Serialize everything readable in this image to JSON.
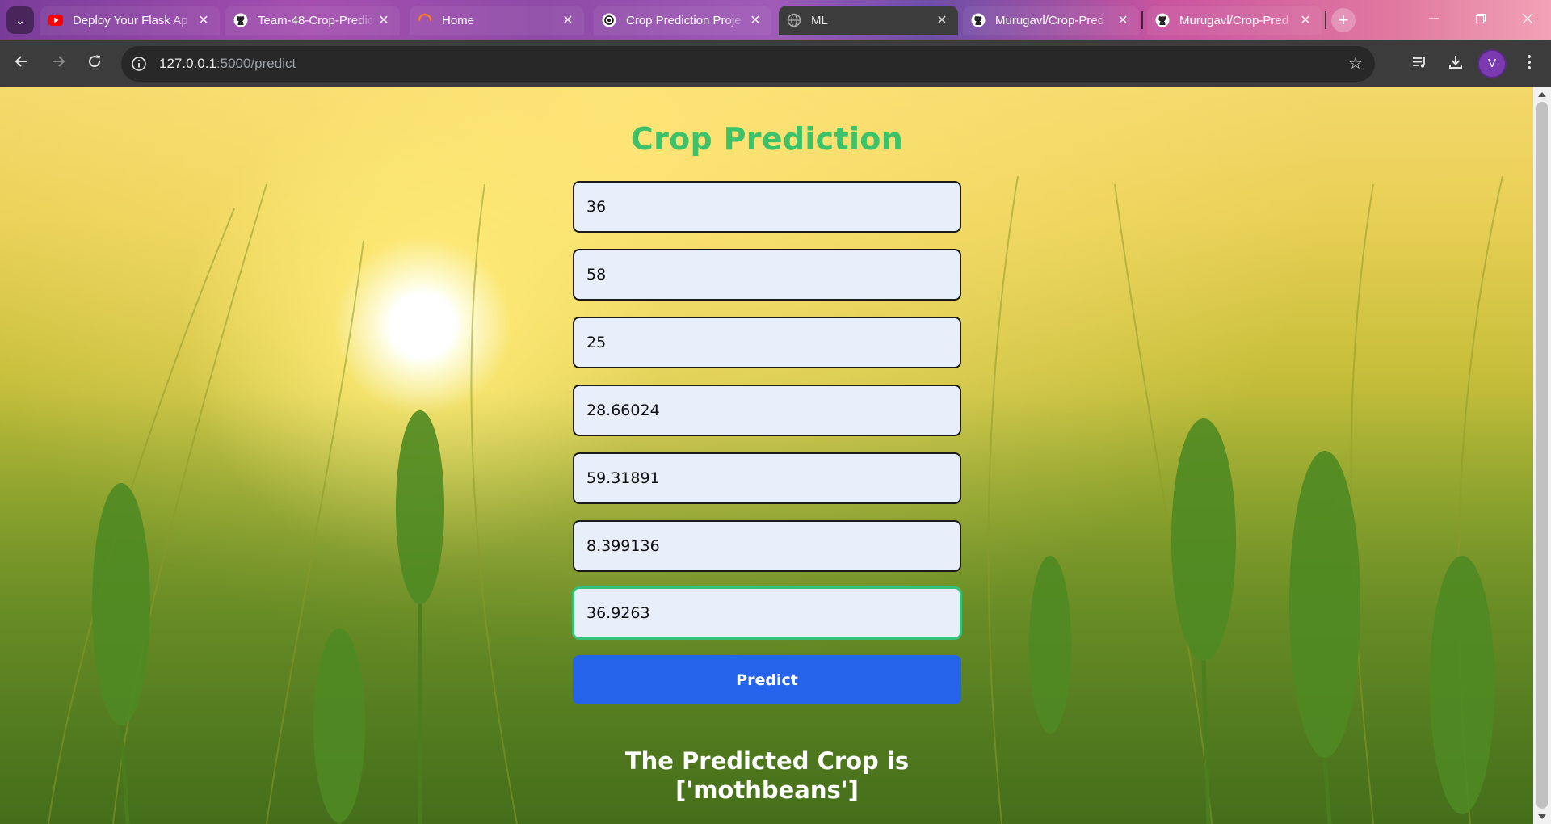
{
  "browser": {
    "tabs": [
      {
        "title": "Deploy Your Flask Ap",
        "favicon": "youtube-icon",
        "active": false
      },
      {
        "title": "Team-48-Crop-Predic",
        "favicon": "github-icon",
        "active": false
      },
      {
        "title": "Home",
        "favicon": "loading-spinner-icon",
        "active": false
      },
      {
        "title": "Crop Prediction Proje",
        "favicon": "openai-icon",
        "active": false
      },
      {
        "title": "ML",
        "favicon": "globe-icon",
        "active": true
      },
      {
        "title": "Murugavl/Crop-Pred",
        "favicon": "github-icon",
        "active": false
      },
      {
        "title": "Murugavl/Crop-Pred",
        "favicon": "github-icon",
        "active": false
      }
    ],
    "url_host": "127.0.0.1",
    "url_path": ":5000/predict",
    "profile_initial": "V",
    "accent": "#7b3ab0"
  },
  "page": {
    "heading": "Crop Prediction",
    "fields": [
      {
        "value": "36"
      },
      {
        "value": "58"
      },
      {
        "value": "25"
      },
      {
        "value": "28.66024"
      },
      {
        "value": "59.31891"
      },
      {
        "value": "8.399136"
      },
      {
        "value": "36.9263",
        "focused": true
      }
    ],
    "predict_label": "Predict",
    "result_line1": "The Predicted Crop is",
    "result_line2": "['mothbeans']",
    "colors": {
      "heading": "#3cc36a",
      "button": "#2563eb",
      "focus_border": "#35c278"
    }
  }
}
